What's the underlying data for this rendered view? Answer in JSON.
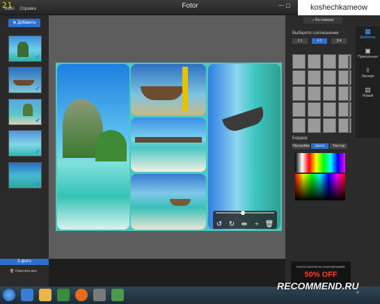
{
  "window": {
    "title": "Fotor",
    "counter": "21"
  },
  "menu": {
    "items": [
      "Файл",
      "Справка"
    ]
  },
  "watermark_user": "koshechkameow",
  "header_button": "На главную",
  "left": {
    "add_button": "Добавить",
    "status": "5 фото",
    "clear_button": "Очистить все"
  },
  "right_tabs": [
    {
      "label": "Шаблоны",
      "icon": "grid-icon",
      "active": true
    },
    {
      "label": "Прикольные",
      "icon": "fun-icon",
      "active": false
    },
    {
      "label": "Экспорт",
      "icon": "export-icon",
      "active": false
    },
    {
      "label": "Новый",
      "icon": "new-icon",
      "active": false
    }
  ],
  "ratio": {
    "label": "Выберите соотношение",
    "options": [
      "1:1",
      "4:3",
      "3:4"
    ],
    "active_index": 1
  },
  "border": {
    "label": "Бордюр",
    "tabs": [
      "Настройки",
      "Цвета",
      "Текстур"
    ],
    "active_tab": 1
  },
  "ad": {
    "line1": "PHOTO EDITOR IN YOUR BROWSER",
    "line2": "50% OFF"
  },
  "overlay_watermark": "RECOMMEND.RU",
  "colors": {
    "accent": "#2c6fd1",
    "collage_bg": "#4cc9c0",
    "ad_red": "#ff3a2a"
  }
}
